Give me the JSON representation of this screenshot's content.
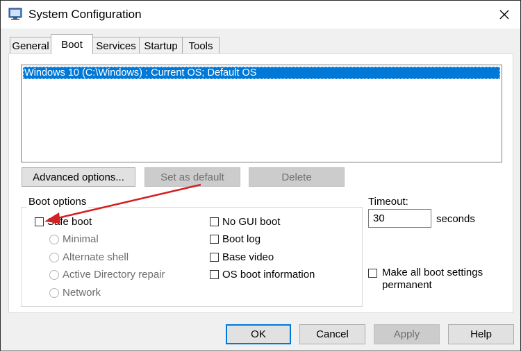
{
  "window": {
    "title": "System Configuration"
  },
  "tabs": [
    {
      "label": "General"
    },
    {
      "label": "Boot"
    },
    {
      "label": "Services"
    },
    {
      "label": "Startup"
    },
    {
      "label": "Tools"
    }
  ],
  "boot_list": {
    "items": [
      "Windows 10 (C:\\Windows) : Current OS; Default OS"
    ]
  },
  "list_buttons": {
    "advanced": "Advanced options...",
    "set_default": "Set as default",
    "delete": "Delete"
  },
  "boot_options": {
    "group_label": "Boot options",
    "safe_boot": "Safe boot",
    "radios": [
      "Minimal",
      "Alternate shell",
      "Active Directory repair",
      "Network"
    ],
    "right_checks": [
      "No GUI boot",
      "Boot log",
      "Base video",
      "OS boot information"
    ]
  },
  "timeout": {
    "label": "Timeout:",
    "value": "30",
    "unit": "seconds"
  },
  "permanent": {
    "label": "Make all boot settings permanent"
  },
  "footer": {
    "ok": "OK",
    "cancel": "Cancel",
    "apply": "Apply",
    "help": "Help"
  },
  "colors": {
    "selection": "#0078d7",
    "annotation_arrow": "#d32020"
  }
}
